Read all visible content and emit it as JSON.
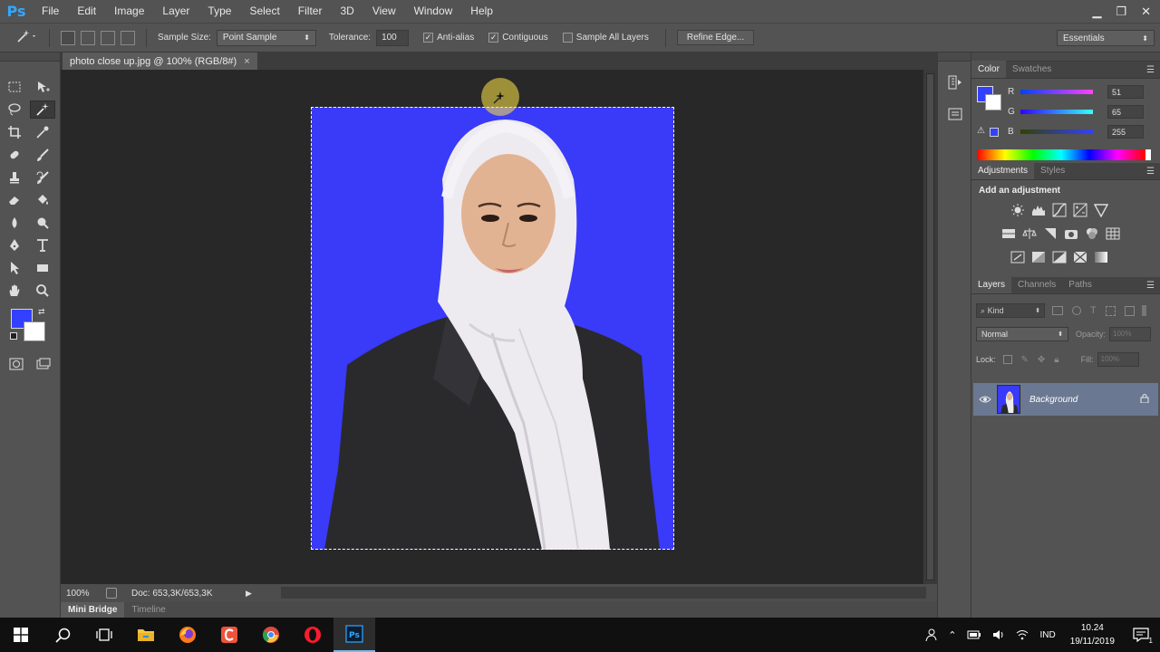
{
  "app": {
    "logo": "Ps",
    "window_controls": [
      "minimize",
      "restore",
      "close"
    ]
  },
  "menu": [
    "File",
    "Edit",
    "Image",
    "Layer",
    "Type",
    "Select",
    "Filter",
    "3D",
    "View",
    "Window",
    "Help"
  ],
  "options": {
    "sample_size_label": "Sample Size:",
    "sample_size_value": "Point Sample",
    "tolerance_label": "Tolerance:",
    "tolerance_value": "100",
    "anti_alias_label": "Anti-alias",
    "anti_alias_checked": true,
    "contiguous_label": "Contiguous",
    "contiguous_checked": true,
    "sample_all_layers_label": "Sample All Layers",
    "sample_all_layers_checked": false,
    "refine_edge_label": "Refine Edge...",
    "workspace": "Essentials"
  },
  "document": {
    "tab_title": "photo close up.jpg @ 100% (RGB/8#)",
    "close_glyph": "×",
    "zoom": "100%",
    "doc_info": "Doc: 653,3K/653,3K",
    "colors": {
      "background": "#3a3af9",
      "selection": "#ffffff"
    }
  },
  "bottom_tabs": [
    "Mini Bridge",
    "Timeline"
  ],
  "color_panel": {
    "tabs": [
      "Color",
      "Swatches"
    ],
    "foreground": "#3341ff",
    "background": "#ffffff",
    "channels": [
      {
        "label": "R",
        "value": "51"
      },
      {
        "label": "G",
        "value": "65"
      },
      {
        "label": "B",
        "value": "255"
      }
    ]
  },
  "adjustments_panel": {
    "tabs": [
      "Adjustments",
      "Styles"
    ],
    "title": "Add an adjustment"
  },
  "layers_panel": {
    "tabs": [
      "Layers",
      "Channels",
      "Paths"
    ],
    "kind_label": "Kind",
    "blend_mode": "Normal",
    "opacity_label": "Opacity:",
    "opacity_value": "100%",
    "lock_label": "Lock:",
    "fill_label": "Fill:",
    "fill_value": "100%",
    "layers": [
      {
        "name": "Background",
        "visible": true,
        "locked": true
      }
    ]
  },
  "taskbar": {
    "tray": {
      "language": "IND",
      "time": "10.24",
      "date": "19/11/2019",
      "notifications": "1"
    }
  }
}
